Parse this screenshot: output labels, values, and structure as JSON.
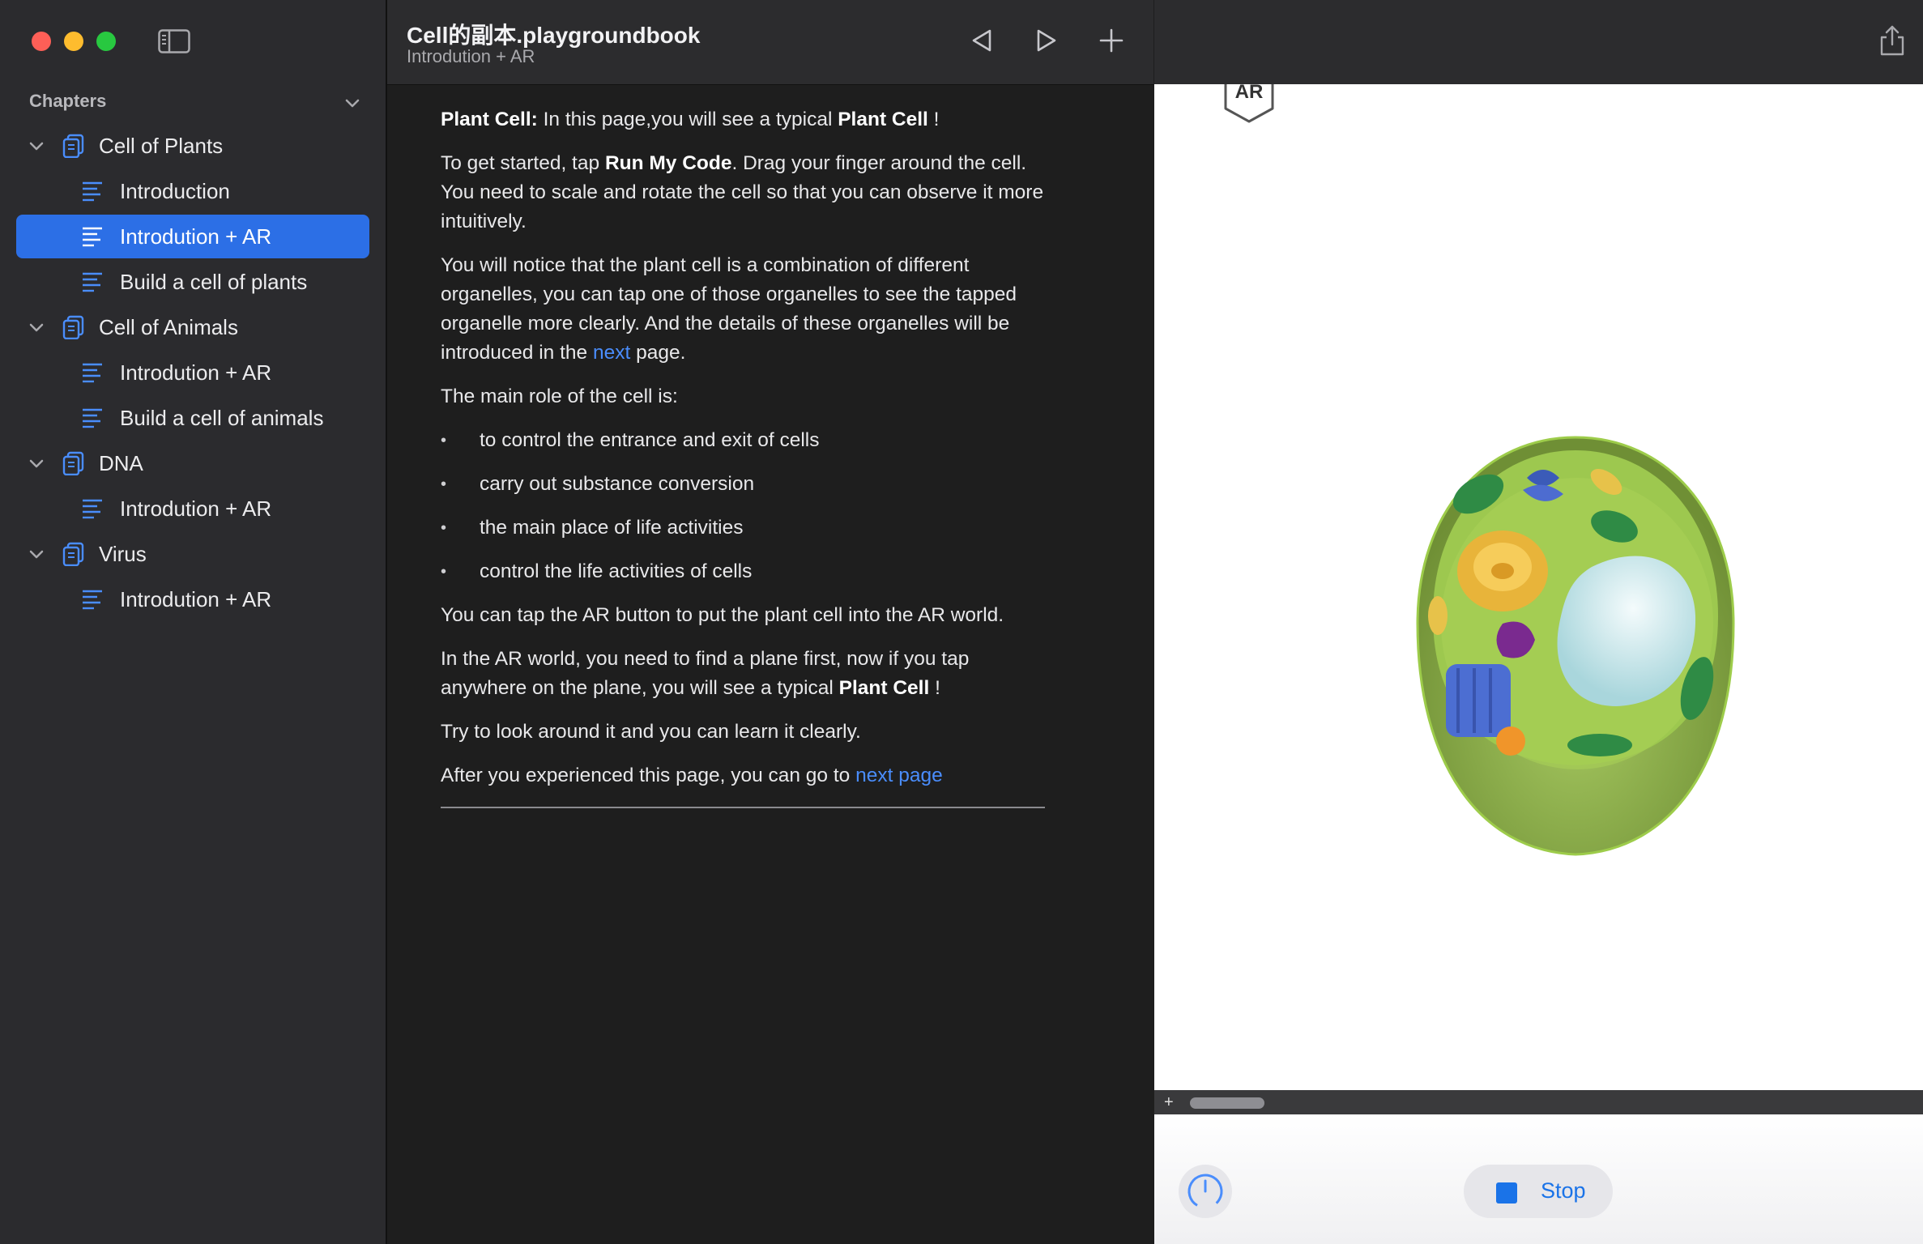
{
  "window": {
    "traffic_lights": [
      "close",
      "minimize",
      "zoom"
    ]
  },
  "sidebar": {
    "header": "Chapters",
    "items": [
      {
        "label": "Cell of Plants",
        "kind": "chapter"
      },
      {
        "label": "Introduction",
        "kind": "page"
      },
      {
        "label": "Introdution + AR",
        "kind": "page",
        "selected": true
      },
      {
        "label": "Build a cell of plants",
        "kind": "page"
      },
      {
        "label": "Cell of Animals",
        "kind": "chapter"
      },
      {
        "label": "Introdution + AR",
        "kind": "page"
      },
      {
        "label": "Build a cell of animals",
        "kind": "page"
      },
      {
        "label": "DNA",
        "kind": "chapter"
      },
      {
        "label": "Introdution + AR",
        "kind": "page"
      },
      {
        "label": "Virus",
        "kind": "chapter"
      },
      {
        "label": "Introdution + AR",
        "kind": "page"
      }
    ]
  },
  "toolbar": {
    "title": "Cell的副本.playgroundbook",
    "subtitle": "Introdution + AR",
    "buttons": [
      "previous-page",
      "next-page",
      "add"
    ]
  },
  "content": {
    "p1": {
      "b1": "Plant Cell:",
      "t1": " In this page,you will see a typical ",
      "b2": "Plant Cell",
      "t2": " !"
    },
    "p2": {
      "t1": "To get started, tap ",
      "b1": "Run My Code",
      "t2": ". Drag your finger around the cell. You need to scale and rotate the cell so that you can observe it more intuitively."
    },
    "p3": {
      "t1": "You will notice that the plant cell is a combination of different organelles, you can tap one of those organelles to see the tapped organelle more clearly. And the details of these organelles will be introduced in the ",
      "link": "next",
      "t2": " page."
    },
    "p4": "The main role of the cell is:",
    "bullets": [
      "to control the entrance and exit of cells",
      "carry out substance conversion",
      "the main place of life activities",
      "control the life activities of cells"
    ],
    "p5": "You can tap the AR button to put the plant cell into the AR world.",
    "p6": {
      "t1": "In the AR world, you need to find a plane first, now if you tap anywhere on the plane, you will see a typical ",
      "b1": "Plant Cell",
      "t2": " !"
    },
    "p7": "Try to look around it and you can learn it clearly.",
    "p8": {
      "t1": "After you experienced this page, you can go to ",
      "link": "next page"
    }
  },
  "live_view": {
    "ar_label": "AR",
    "scroll_plus": "+",
    "stop_label": "Stop",
    "accent": "#1a73e8"
  }
}
